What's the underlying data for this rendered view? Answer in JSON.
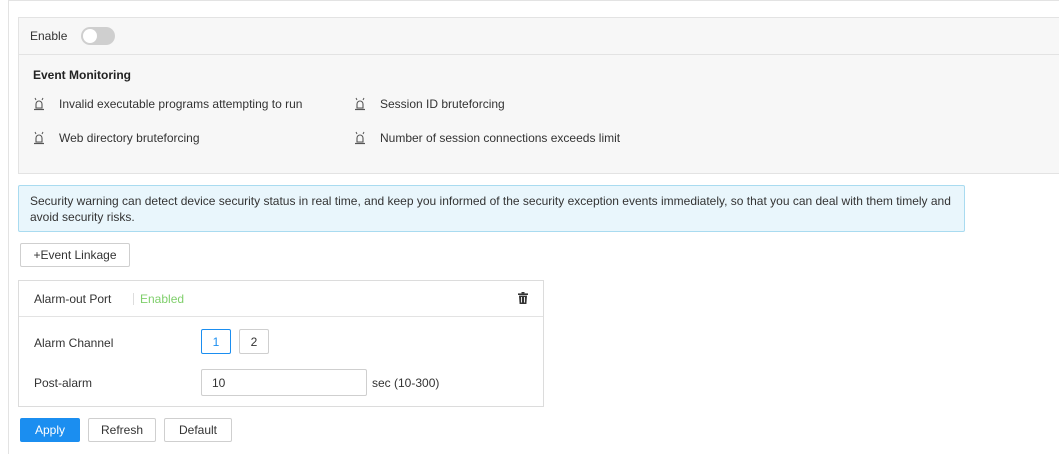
{
  "enable": {
    "label": "Enable",
    "state": "off"
  },
  "event_monitoring": {
    "title": "Event Monitoring",
    "icon": "alarm-light-icon",
    "items": [
      {
        "label": "Invalid executable programs attempting to run"
      },
      {
        "label": "Session ID bruteforcing"
      },
      {
        "label": "Web directory bruteforcing"
      },
      {
        "label": "Number of session connections exceeds limit"
      }
    ]
  },
  "info": {
    "text": "Security warning can detect device security status in real time, and keep you informed of the security exception events immediately, so that you can deal with them timely and avoid security risks."
  },
  "event_linkage_button": "+Event Linkage",
  "alarm_card": {
    "title": "Alarm-out Port",
    "status": "Enabled",
    "channel_label": "Alarm Channel",
    "channels": [
      "1",
      "2"
    ],
    "selected_channel": "1",
    "post_alarm_label": "Post-alarm",
    "post_alarm_value": "10",
    "post_alarm_unit": "sec (10-300)"
  },
  "buttons": {
    "apply": "Apply",
    "refresh": "Refresh",
    "default": "Default"
  },
  "colors": {
    "primary": "#1b8ef0",
    "enabled_status": "#7fcf6b",
    "info_bg": "#e9f6fc",
    "info_border": "#a9dbf0",
    "toggle_off": "#cfcfcf"
  }
}
